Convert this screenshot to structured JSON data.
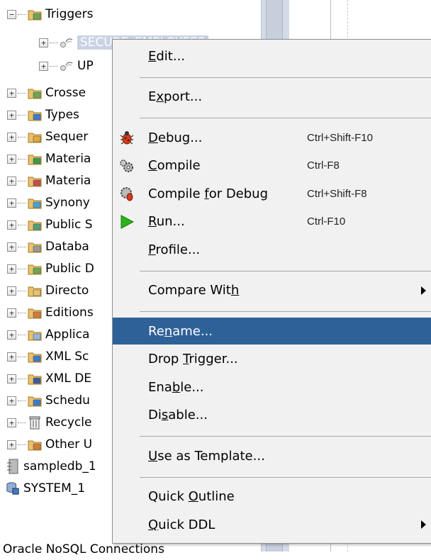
{
  "tree": {
    "items": [
      {
        "label": "Triggers",
        "icon": "triggers-folder-icon",
        "expander": "−",
        "indent": 0
      },
      {
        "label": "SECURE_EMPLOYEES",
        "icon": "trigger-icon",
        "expander": "+",
        "indent": 1,
        "selected": true
      },
      {
        "label": "UP",
        "icon": "trigger-icon",
        "expander": "+",
        "indent": 1
      },
      {
        "label": "Crosse",
        "icon": "crossedition-folder-icon",
        "expander": "+",
        "indent": 0
      },
      {
        "label": "Types",
        "icon": "types-folder-icon",
        "expander": "+",
        "indent": 0
      },
      {
        "label": "Sequer",
        "icon": "sequences-folder-icon",
        "expander": "+",
        "indent": 0
      },
      {
        "label": "Materia",
        "icon": "materialized-view-folder-icon",
        "expander": "+",
        "indent": 0
      },
      {
        "label": "Materia",
        "icon": "materialized-view-log-folder-icon",
        "expander": "+",
        "indent": 0
      },
      {
        "label": "Synony",
        "icon": "synonyms-folder-icon",
        "expander": "+",
        "indent": 0
      },
      {
        "label": "Public S",
        "icon": "public-synonyms-folder-icon",
        "expander": "+",
        "indent": 0
      },
      {
        "label": "Databa",
        "icon": "database-links-folder-icon",
        "expander": "+",
        "indent": 0
      },
      {
        "label": "Public D",
        "icon": "public-database-links-folder-icon",
        "expander": "+",
        "indent": 0
      },
      {
        "label": "Directo",
        "icon": "directories-folder-icon",
        "expander": "+",
        "indent": 0
      },
      {
        "label": "Editions",
        "icon": "editions-folder-icon",
        "expander": "+",
        "indent": 0
      },
      {
        "label": "Applica",
        "icon": "application-express-folder-icon",
        "expander": "+",
        "indent": 0
      },
      {
        "label": "XML Sc",
        "icon": "xml-schemas-folder-icon",
        "expander": "+",
        "indent": 0
      },
      {
        "label": "XML DE",
        "icon": "xml-db-folder-icon",
        "expander": "+",
        "indent": 0
      },
      {
        "label": "Schedu",
        "icon": "scheduler-folder-icon",
        "expander": "+",
        "indent": 0
      },
      {
        "label": "Recycle",
        "icon": "recycle-bin-icon",
        "expander": "+",
        "indent": 0
      },
      {
        "label": "Other U",
        "icon": "other-users-folder-icon",
        "expander": "+",
        "indent": 0
      },
      {
        "label": "sampledb_1",
        "icon": "connection-icon",
        "expander": "",
        "indent": -1
      },
      {
        "label": "SYSTEM_1",
        "icon": "db-connection-icon",
        "expander": "",
        "indent": -1
      }
    ],
    "footer": "Oracle NoSQL Connections"
  },
  "menu": {
    "items": [
      {
        "type": "item",
        "pre": "",
        "ul": "E",
        "post": "dit...",
        "key": "",
        "icon": ""
      },
      {
        "type": "sep"
      },
      {
        "type": "item",
        "pre": "E",
        "ul": "x",
        "post": "port...",
        "key": "",
        "icon": ""
      },
      {
        "type": "sep"
      },
      {
        "type": "item",
        "pre": "",
        "ul": "D",
        "post": "ebug...",
        "key": "Ctrl+Shift-F10",
        "icon": "debug-bug-icon"
      },
      {
        "type": "item",
        "pre": "",
        "ul": "C",
        "post": "ompile",
        "key": "Ctrl-F8",
        "icon": "compile-gear-icon"
      },
      {
        "type": "item",
        "pre": "Compile ",
        "ul": "f",
        "post": "or Debug",
        "key": "Ctrl+Shift-F8",
        "icon": "compile-debug-gear-icon"
      },
      {
        "type": "item",
        "pre": "",
        "ul": "R",
        "post": "un...",
        "key": "Ctrl-F10",
        "icon": "run-play-icon"
      },
      {
        "type": "item",
        "pre": "",
        "ul": "P",
        "post": "rofile...",
        "key": "",
        "icon": ""
      },
      {
        "type": "sep"
      },
      {
        "type": "item",
        "pre": "Compare Wit",
        "ul": "h",
        "post": "",
        "key": "",
        "icon": "",
        "submenu": true
      },
      {
        "type": "sep"
      },
      {
        "type": "item",
        "pre": "Re",
        "ul": "n",
        "post": "ame...",
        "key": "",
        "icon": "",
        "highlighted": true
      },
      {
        "type": "item",
        "pre": "Drop ",
        "ul": "T",
        "post": "rigger...",
        "key": "",
        "icon": ""
      },
      {
        "type": "item",
        "pre": "Ena",
        "ul": "b",
        "post": "le...",
        "key": "",
        "icon": ""
      },
      {
        "type": "item",
        "pre": "Di",
        "ul": "s",
        "post": "able...",
        "key": "",
        "icon": ""
      },
      {
        "type": "sep"
      },
      {
        "type": "item",
        "pre": "",
        "ul": "U",
        "post": "se as Template...",
        "key": "",
        "icon": ""
      },
      {
        "type": "sep"
      },
      {
        "type": "item",
        "pre": "Quick ",
        "ul": "O",
        "post": "utline",
        "key": "",
        "icon": ""
      },
      {
        "type": "item",
        "pre": "",
        "ul": "Q",
        "post": "uick DDL",
        "key": "",
        "icon": "",
        "submenu": true
      }
    ]
  },
  "colors": {
    "highlight": "#2f6199",
    "menu_bg": "#f1f1f1",
    "run_green": "#2bb31c",
    "debug_red": "#d23a1a"
  }
}
